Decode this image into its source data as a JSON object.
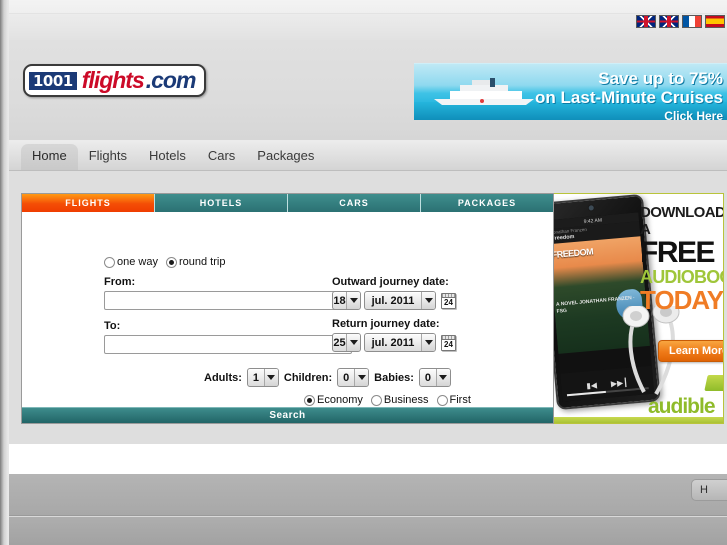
{
  "header": {
    "logo": {
      "prefix": "1001",
      "name": "flights",
      "tld": ".com"
    },
    "languages": [
      {
        "name": "english-uk-flag",
        "label": "EN"
      },
      {
        "name": "english-gb-flag",
        "label": "GB"
      },
      {
        "name": "french-flag",
        "label": "FR"
      },
      {
        "name": "spanish-flag",
        "label": "ES"
      }
    ]
  },
  "banner_cruise": {
    "line1": "Save up to 75%",
    "line2": "on Last-Minute Cruises",
    "cta": "Click Here"
  },
  "mainnav": {
    "items": [
      {
        "label": "Home",
        "active": true
      },
      {
        "label": "Flights",
        "active": false
      },
      {
        "label": "Hotels",
        "active": false
      },
      {
        "label": "Cars",
        "active": false
      },
      {
        "label": "Packages",
        "active": false
      }
    ]
  },
  "search_panel": {
    "tabs": [
      {
        "label": "FLIGHTS",
        "active": true
      },
      {
        "label": "HOTELS",
        "active": false
      },
      {
        "label": "CARS",
        "active": false
      },
      {
        "label": "PACKAGES",
        "active": false
      }
    ],
    "trip_type": {
      "one_way_label": "one way",
      "round_trip_label": "round trip",
      "selected": "round trip"
    },
    "from": {
      "label": "From:",
      "value": "",
      "placeholder": ""
    },
    "to": {
      "label": "To:",
      "value": "",
      "placeholder": ""
    },
    "outward": {
      "label": "Outward journey date:",
      "day": "18",
      "month": "jul. 2011",
      "calendar_day": "24"
    },
    "return": {
      "label": "Return journey date:",
      "day": "25",
      "month": "jul. 2011",
      "calendar_day": "24"
    },
    "passengers": {
      "adults_label": "Adults:",
      "adults_value": "1",
      "children_label": "Children:",
      "children_value": "0",
      "babies_label": "Babies:",
      "babies_value": "0"
    },
    "cabin_class": {
      "options": [
        "Economy",
        "Business",
        "First"
      ],
      "selected": "Economy"
    },
    "search_label": "Search",
    "colors": {
      "active_tab": "#f44d06",
      "tab_bar": "#2f7b7d",
      "search_bar": "#2f7b7d"
    }
  },
  "ad_audible": {
    "line1": "DOWNLOAD A",
    "line2": "FREE",
    "line3": "AUDIOBOOK",
    "line4": "TODAY",
    "button": "Learn More",
    "brand": "audible",
    "phone": {
      "time": "9:42 AM",
      "author": "Jonathan Franzen",
      "title": "Freedom",
      "cover_title": "FREEDOM",
      "cover_sub": "A NOVEL JONATHAN FRANZEN · FSG"
    }
  },
  "footer": {
    "cut_button_label": "H"
  }
}
